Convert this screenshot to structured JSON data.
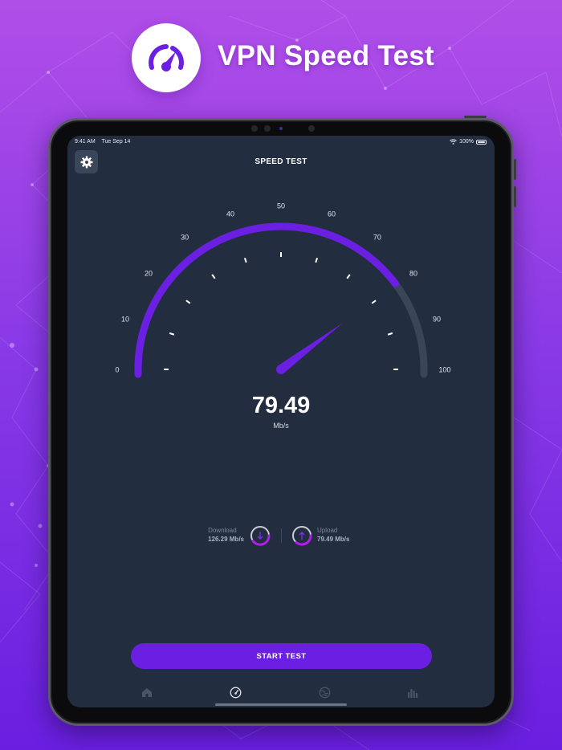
{
  "promo": {
    "title": "VPN Speed Test",
    "logo_icon": "speedometer-icon"
  },
  "colors": {
    "accent": "#6b1fe3",
    "accent_bright": "#7d2ff0",
    "screen_bg": "#222d40",
    "track": "#3a4658"
  },
  "status_bar": {
    "time": "9:41 AM",
    "date": "Tue Sep 14",
    "battery": "100%"
  },
  "header": {
    "title": "SPEED TEST",
    "settings_icon": "gear-icon"
  },
  "gauge": {
    "min": 0,
    "max": 100,
    "labels": [
      "0",
      "10",
      "20",
      "30",
      "40",
      "50",
      "60",
      "70",
      "80",
      "90",
      "100"
    ],
    "current_value": 79.49
  },
  "result": {
    "value": "79.49",
    "unit": "Mb/s"
  },
  "stats": {
    "download": {
      "label": "Download",
      "value": "126.29 Mb/s",
      "icon": "download-arrow-icon"
    },
    "upload": {
      "label": "Upload",
      "value": "79.49 Mb/s",
      "icon": "upload-arrow-icon"
    }
  },
  "start_button": {
    "label": "START TEST"
  },
  "tabs": [
    {
      "name": "tab-home",
      "icon": "home-icon"
    },
    {
      "name": "tab-speed-test",
      "icon": "speedometer-icon",
      "active": true
    },
    {
      "name": "tab-vpn",
      "icon": "globe-icon"
    },
    {
      "name": "tab-history",
      "icon": "bar-chart-icon"
    }
  ]
}
